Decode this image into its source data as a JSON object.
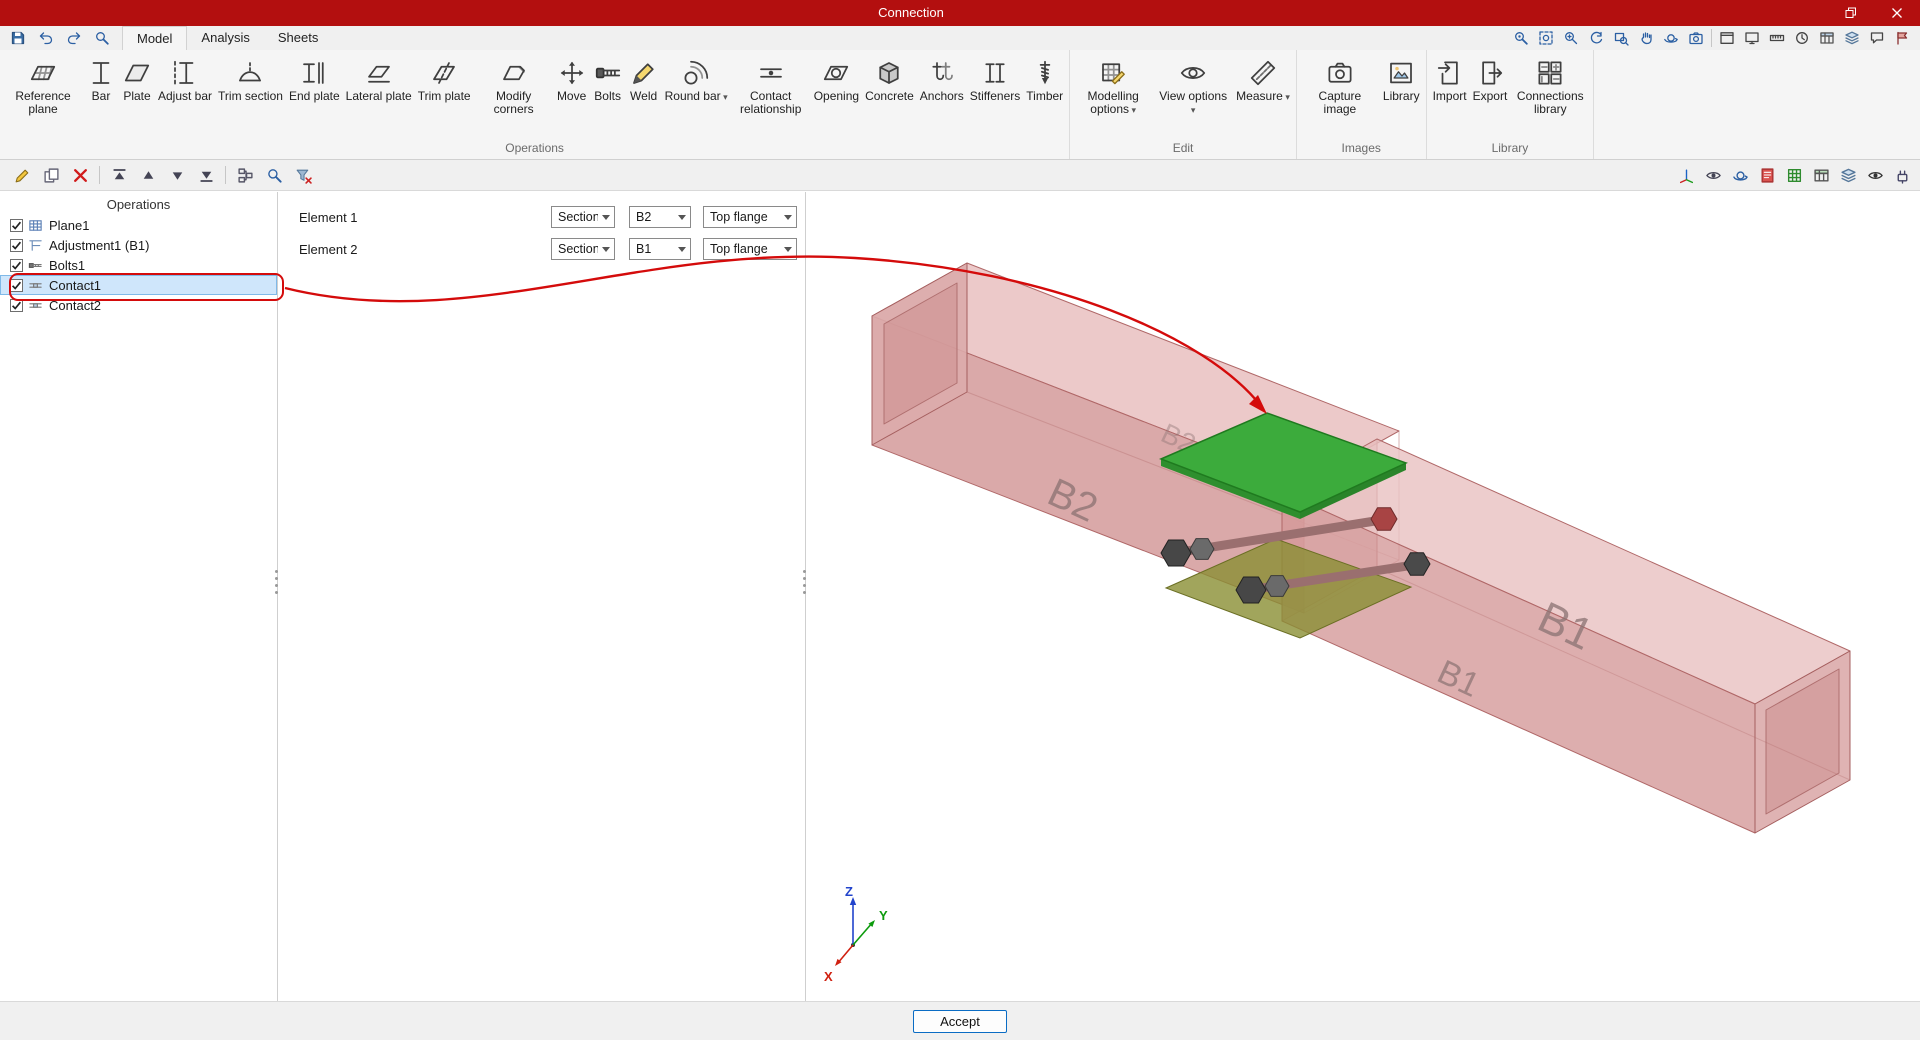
{
  "window": {
    "title": "Connection",
    "controls": [
      "restore",
      "close"
    ]
  },
  "tab_bar": {
    "quick_icons": [
      "save",
      "undo",
      "redo",
      "search"
    ],
    "tabs": [
      {
        "label": "Model",
        "active": true
      },
      {
        "label": "Analysis",
        "active": false
      },
      {
        "label": "Sheets",
        "active": false
      }
    ],
    "view_icons": [
      "find",
      "zoom-extents",
      "zoom-in",
      "refresh",
      "zoom-window",
      "pan",
      "orbit",
      "camera",
      "separator",
      "window",
      "screen",
      "ruler",
      "clock",
      "table",
      "layers",
      "comment",
      "flag"
    ]
  },
  "ribbon": {
    "groups": [
      {
        "name": "Operations",
        "buttons": [
          {
            "label": "Reference plane",
            "icon": "reference-plane"
          },
          {
            "label": "Bar",
            "icon": "bar"
          },
          {
            "label": "Plate",
            "icon": "plate"
          },
          {
            "label": "Adjust bar",
            "icon": "adjust-bar"
          },
          {
            "label": "Trim section",
            "icon": "trim-section"
          },
          {
            "label": "End plate",
            "icon": "end-plate"
          },
          {
            "label": "Lateral plate",
            "icon": "lateral-plate"
          },
          {
            "label": "Trim plate",
            "icon": "trim-plate"
          },
          {
            "label": "Modify corners",
            "icon": "modify-corners"
          },
          {
            "label": "Move",
            "icon": "move"
          },
          {
            "label": "Bolts",
            "icon": "bolts"
          },
          {
            "label": "Weld",
            "icon": "weld"
          },
          {
            "label": "Round bar",
            "icon": "round-bar",
            "dropdown": true
          },
          {
            "label": "Contact relationship",
            "icon": "contact-relationship"
          },
          {
            "label": "Opening",
            "icon": "opening"
          },
          {
            "label": "Concrete",
            "icon": "concrete"
          },
          {
            "label": "Anchors",
            "icon": "anchors"
          },
          {
            "label": "Stiffeners",
            "icon": "stiffeners"
          },
          {
            "label": "Timber",
            "icon": "timber"
          }
        ]
      },
      {
        "name": "Edit",
        "buttons": [
          {
            "label": "Modelling options",
            "icon": "modelling-options",
            "dropdown": true
          },
          {
            "label": "View options",
            "icon": "view-options",
            "dropdown": true
          },
          {
            "label": "Measure",
            "icon": "measure",
            "dropdown": true
          }
        ]
      },
      {
        "name": "Images",
        "buttons": [
          {
            "label": "Capture image",
            "icon": "capture-image"
          },
          {
            "label": "Library",
            "icon": "library"
          }
        ]
      },
      {
        "name": "Library",
        "buttons": [
          {
            "label": "Import",
            "icon": "import"
          },
          {
            "label": "Export",
            "icon": "export"
          },
          {
            "label": "Connections library",
            "icon": "connections-library"
          }
        ]
      }
    ]
  },
  "operations": {
    "title": "Operations",
    "toolbar": [
      "edit",
      "duplicate",
      "delete",
      "separator",
      "move-first",
      "move-up",
      "move-down",
      "move-last",
      "separator",
      "copy-structure",
      "search",
      "filter-clear"
    ],
    "items": [
      {
        "label": "Plane1",
        "icon": "plane",
        "checked": true,
        "selected": false
      },
      {
        "label": "Adjustment1 (B1)",
        "icon": "adjustment",
        "checked": true,
        "selected": false
      },
      {
        "label": "Bolts1",
        "icon": "bolts-item",
        "checked": true,
        "selected": false
      },
      {
        "label": "Contact1",
        "icon": "contact-item",
        "checked": true,
        "selected": true
      },
      {
        "label": "Contact2",
        "icon": "contact-item",
        "checked": true,
        "selected": false
      }
    ]
  },
  "properties": {
    "rows": [
      {
        "label": "Element 1",
        "fields": [
          {
            "value": "Section"
          },
          {
            "value": "B2"
          },
          {
            "value": "Top flange"
          }
        ]
      },
      {
        "label": "Element 2",
        "fields": [
          {
            "value": "Section"
          },
          {
            "value": "B1"
          },
          {
            "value": "Top flange"
          }
        ]
      }
    ]
  },
  "viewport": {
    "member_labels": {
      "b2": "B2",
      "b2_hidden": "B2",
      "b1_near": "B1",
      "b1_far": "B1"
    },
    "axis_labels": {
      "x": "X",
      "y": "Y",
      "z": "Z"
    },
    "toolbar_icons": [
      "triad",
      "perspective",
      "orbit",
      "report",
      "mesh",
      "tables",
      "layers",
      "visibility",
      "plugin"
    ]
  },
  "footer": {
    "accept": "Accept"
  },
  "colors": {
    "titlebar": "#b30f0f",
    "accent": "#0a6cc4",
    "selection": "#cfe6fb",
    "annotation": "#d40b0b",
    "beam_fill": "#d89898",
    "contact_green": "#3cab3c"
  }
}
